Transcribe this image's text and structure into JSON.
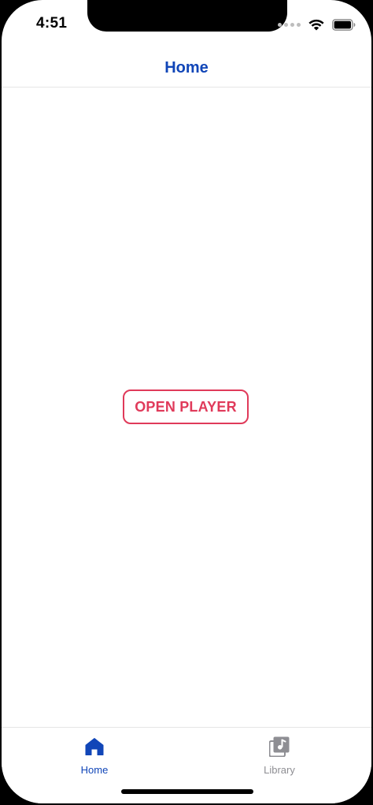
{
  "status_bar": {
    "time": "4:51"
  },
  "nav_bar": {
    "title": "Home"
  },
  "main": {
    "open_player_label": "OPEN PLAYER"
  },
  "tab_bar": {
    "tabs": [
      {
        "label": "Home",
        "icon": "home-icon",
        "selected": true
      },
      {
        "label": "Library",
        "icon": "music-library-icon",
        "selected": false
      }
    ]
  },
  "colors": {
    "accent": "#1146b8",
    "button": "#e03a5a",
    "inactive": "#8e8e93"
  }
}
